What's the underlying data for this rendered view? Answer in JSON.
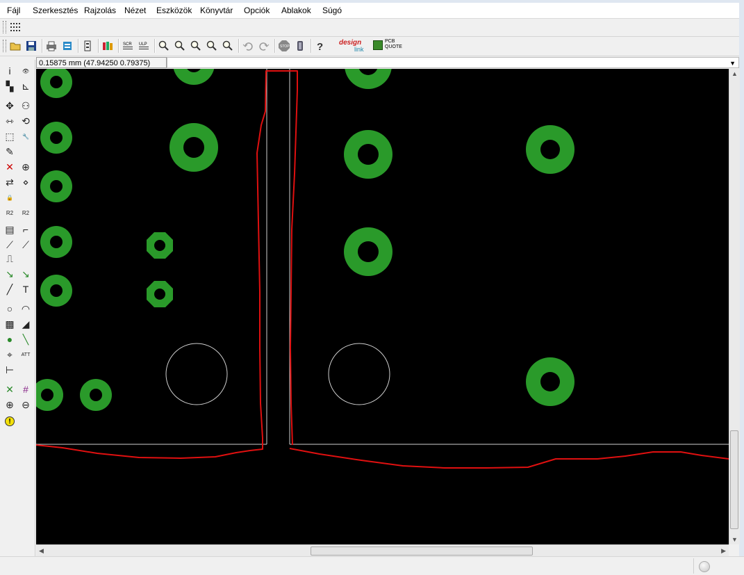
{
  "menu": [
    "Fájl",
    "Szerkesztés",
    "Rajzolás",
    "Nézet",
    "Eszközök",
    "Könyvtár",
    "Opciók",
    "Ablakok",
    "Súgó"
  ],
  "toolbar": {
    "items": [
      {
        "name": "open-icon",
        "icon": "folder"
      },
      {
        "name": "save-icon",
        "icon": "floppy"
      },
      {
        "sep": true
      },
      {
        "name": "print-icon",
        "icon": "printer"
      },
      {
        "name": "export-icon",
        "icon": "export"
      },
      {
        "sep": true
      },
      {
        "name": "board-settings-icon",
        "icon": "board"
      },
      {
        "sep": true
      },
      {
        "name": "library-icon",
        "icon": "books"
      },
      {
        "sep": true
      },
      {
        "name": "scr-icon",
        "icon": "scr"
      },
      {
        "name": "ulp-icon",
        "icon": "ulp"
      },
      {
        "sep": true
      },
      {
        "name": "zoom-fit-icon",
        "icon": "zoom"
      },
      {
        "name": "zoom-in-icon",
        "icon": "zoom"
      },
      {
        "name": "zoom-out-icon",
        "icon": "zoom"
      },
      {
        "name": "zoom-redraw-icon",
        "icon": "zoom"
      },
      {
        "name": "zoom-select-icon",
        "icon": "zoom"
      },
      {
        "sep": true
      },
      {
        "name": "undo-icon",
        "icon": "undo"
      },
      {
        "name": "redo-icon",
        "icon": "redo"
      },
      {
        "sep": true
      },
      {
        "name": "stop-icon",
        "icon": "stop"
      },
      {
        "name": "go-icon",
        "icon": "go"
      },
      {
        "sep": true
      },
      {
        "name": "help-icon",
        "icon": "help"
      }
    ],
    "design_link": {
      "top": "design",
      "bottom": "link"
    },
    "pcb_quote": {
      "top": "PCB",
      "bottom": "QUOTE"
    }
  },
  "coords": "0.15875 mm (47.94250 0.79375)",
  "left_tools": [
    {
      "name": "info-icon",
      "glyph": "i"
    },
    {
      "name": "show-icon",
      "glyph": "👁"
    },
    {
      "name": "display-layers-icon",
      "glyph": "▚"
    },
    {
      "name": "mark-icon",
      "glyph": "⊾"
    },
    {
      "name": "move-icon",
      "glyph": "✥"
    },
    {
      "name": "copy-icon",
      "glyph": "⚇"
    },
    {
      "name": "mirror-icon",
      "glyph": "⇿"
    },
    {
      "name": "rotate-icon",
      "glyph": "⟲"
    },
    {
      "name": "group-icon",
      "glyph": "⬚"
    },
    {
      "name": "change-icon",
      "glyph": "🔧"
    },
    {
      "name": "paste-icon",
      "glyph": "✎"
    },
    {
      "name": "blank1",
      "glyph": ""
    },
    {
      "name": "delete-icon",
      "glyph": "✕"
    },
    {
      "name": "add-icon",
      "glyph": "⊕"
    },
    {
      "name": "replace-icon",
      "glyph": "⇄"
    },
    {
      "name": "lock-part-icon",
      "glyph": "⋄"
    },
    {
      "name": "lock-icon",
      "glyph": "🔒"
    },
    {
      "name": "blank2",
      "glyph": ""
    },
    {
      "name": "name-icon",
      "glyph": "R2"
    },
    {
      "name": "value-icon",
      "glyph": "R2"
    },
    {
      "name": "smash-icon",
      "glyph": "▤"
    },
    {
      "name": "miter-icon",
      "glyph": "⌐"
    },
    {
      "name": "split-icon",
      "glyph": "⟋"
    },
    {
      "name": "optimize-icon",
      "glyph": "⟋"
    },
    {
      "name": "meander-icon",
      "glyph": "⎍"
    },
    {
      "name": "blank3",
      "glyph": ""
    },
    {
      "name": "route-icon",
      "glyph": "↘"
    },
    {
      "name": "ripup-icon",
      "glyph": "↘"
    },
    {
      "name": "wire-icon",
      "glyph": "╱"
    },
    {
      "name": "text-icon",
      "glyph": "T"
    },
    {
      "name": "circle-icon",
      "glyph": "○"
    },
    {
      "name": "arc-icon",
      "glyph": "◠"
    },
    {
      "name": "rect-icon",
      "glyph": "▩"
    },
    {
      "name": "polygon-icon",
      "glyph": "◢"
    },
    {
      "name": "via-icon",
      "glyph": "●"
    },
    {
      "name": "signal-icon",
      "glyph": "╲"
    },
    {
      "name": "hole-icon",
      "glyph": "⌖"
    },
    {
      "name": "attribute-icon",
      "glyph": "ATT"
    },
    {
      "name": "dimension-icon",
      "glyph": "⊢"
    },
    {
      "name": "blank4",
      "glyph": ""
    },
    {
      "name": "ratsnest-icon",
      "glyph": "✕"
    },
    {
      "name": "autorouter-icon",
      "glyph": "#"
    },
    {
      "name": "drc-icon",
      "glyph": "⊕"
    },
    {
      "name": "errors-icon",
      "glyph": "⊖"
    },
    {
      "name": "erc-icon",
      "glyph": "!"
    }
  ],
  "colors": {
    "background": "#000000",
    "pad": "#2a9a2a",
    "outline": "#e01010",
    "line": "#cfcfcf"
  }
}
